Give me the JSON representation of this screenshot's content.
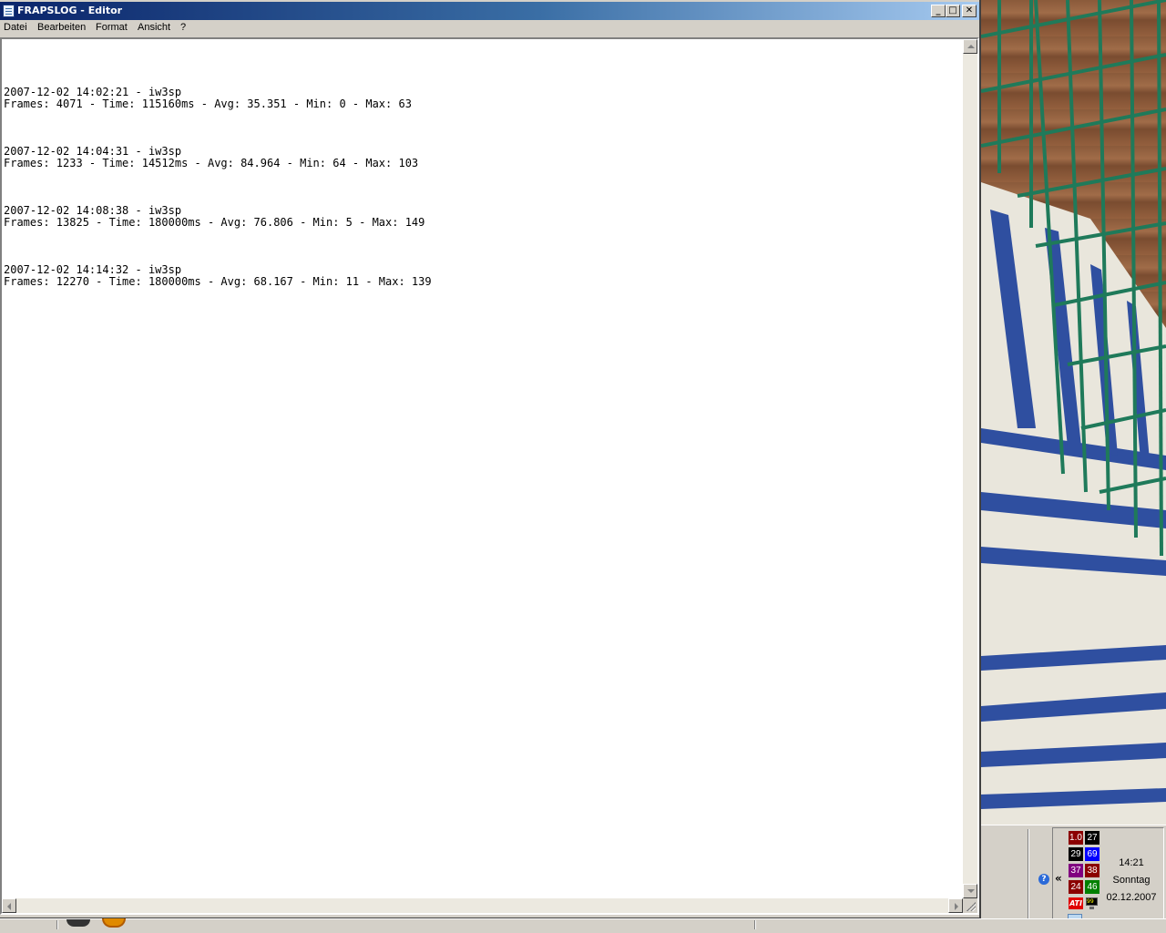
{
  "window": {
    "title": "FRAPSLOG - Editor",
    "controls": {
      "minimize": "_",
      "maximize": "□",
      "close": "✕"
    }
  },
  "menu": {
    "items": [
      "Datei",
      "Bearbeiten",
      "Format",
      "Ansicht",
      "?"
    ]
  },
  "document": {
    "entries": [
      {
        "header": "2007-12-02 14:02:21 - iw3sp",
        "stats": "Frames: 4071 - Time: 115160ms - Avg: 35.351 - Min: 0 - Max: 63"
      },
      {
        "header": "2007-12-02 14:04:31 - iw3sp",
        "stats": "Frames: 1233 - Time: 14512ms - Avg: 84.964 - Min: 64 - Max: 103"
      },
      {
        "header": "2007-12-02 14:08:38 - iw3sp",
        "stats": "Frames: 13825 - Time: 180000ms - Avg: 76.806 - Min: 5 - Max: 149"
      },
      {
        "header": "2007-12-02 14:14:32 - iw3sp",
        "stats": "Frames: 12270 - Time: 180000ms - Avg: 68.167 - Min: 11 - Max: 139"
      }
    ]
  },
  "tray": {
    "help": "?",
    "expand": "«",
    "monitors": [
      {
        "value": "1.0",
        "bg": "#8b0000"
      },
      {
        "value": "27",
        "bg": "#000000"
      },
      {
        "value": "29",
        "bg": "#000000"
      },
      {
        "value": "69",
        "bg": "#0000ff"
      },
      {
        "value": "37",
        "bg": "#800080"
      },
      {
        "value": "38",
        "bg": "#8b0000"
      },
      {
        "value": "24",
        "bg": "#8b0000"
      },
      {
        "value": "46",
        "bg": "#008000"
      }
    ],
    "ati_label": "ATI",
    "monitor_badge": "99",
    "clock": {
      "time": "14:21",
      "day": "Sonntag",
      "date": "02.12.2007"
    }
  },
  "colors": {
    "titlebar_start": "#0a246a",
    "titlebar_end": "#a6caf0",
    "chrome": "#d4d0c8",
    "cage_green": "#1f7a5a",
    "blanket_blue": "#2f4fa0"
  }
}
